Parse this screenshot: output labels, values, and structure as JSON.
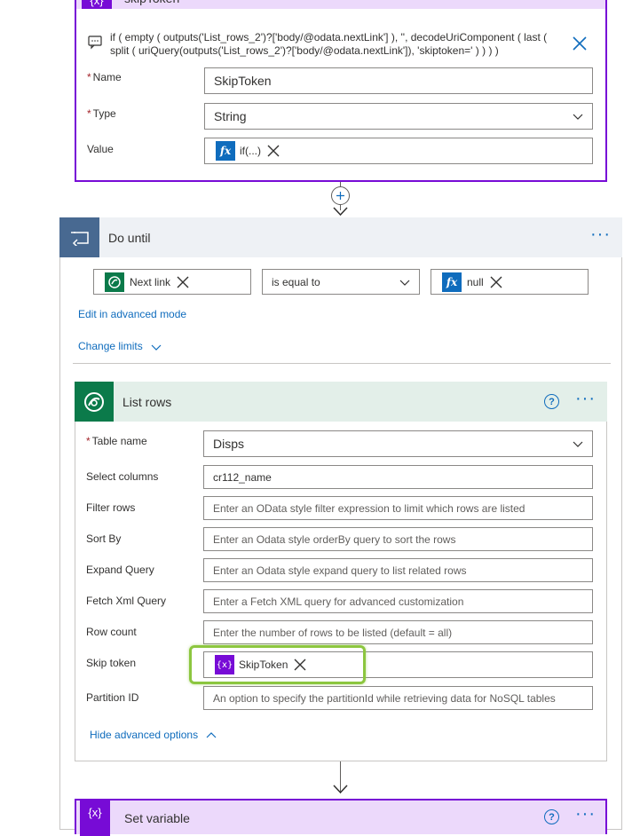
{
  "skiptoken_card": {
    "title": "skipToken",
    "expression": "if ( empty ( outputs('List_rows_2')?['body/@odata.nextLink'] ), '', decodeUriComponent ( last ( split ( uriQuery(outputs('List_rows_2')?['body/@odata.nextLink']), 'skiptoken=' ) ) ) )",
    "name_label": "Name",
    "name_value": "SkipToken",
    "type_label": "Type",
    "type_value": "String",
    "value_label": "Value",
    "value_token": "if(...)",
    "fx_label": "fx",
    "required_mark": "*"
  },
  "do_until": {
    "title": "Do until",
    "condition_left": "Next link",
    "operator": "is equal to",
    "condition_right": "null",
    "edit_advanced": "Edit in advanced mode",
    "change_limits": "Change limits"
  },
  "list_rows": {
    "title": "List rows",
    "table_name_label": "Table name",
    "table_name_value": "Disps",
    "select_columns_label": "Select columns",
    "select_columns_value": "cr112_name",
    "filter_rows_label": "Filter rows",
    "filter_rows_placeholder": "Enter an OData style filter expression to limit which rows are listed",
    "sort_by_label": "Sort By",
    "sort_by_placeholder": "Enter an Odata style orderBy query to sort the rows",
    "expand_query_label": "Expand Query",
    "expand_query_placeholder": "Enter an Odata style expand query to list related rows",
    "fetch_xml_label": "Fetch Xml Query",
    "fetch_xml_placeholder": "Enter a Fetch XML query for advanced customization",
    "row_count_label": "Row count",
    "row_count_placeholder": "Enter the number of rows to be listed (default = all)",
    "skip_token_label": "Skip token",
    "skip_token_value": "SkipToken",
    "partition_label": "Partition ID",
    "partition_placeholder": "An option to specify the partitionId while retrieving data for NoSQL tables",
    "hide_advanced": "Hide advanced options"
  },
  "set_variable": {
    "title": "Set variable"
  },
  "colors": {
    "variable_purple": "#770bd6",
    "dataverse_green": "#0b7a4a",
    "loop_blue": "#486991",
    "link_blue": "#0f6cbd",
    "highlight_green": "#8cc63f"
  }
}
